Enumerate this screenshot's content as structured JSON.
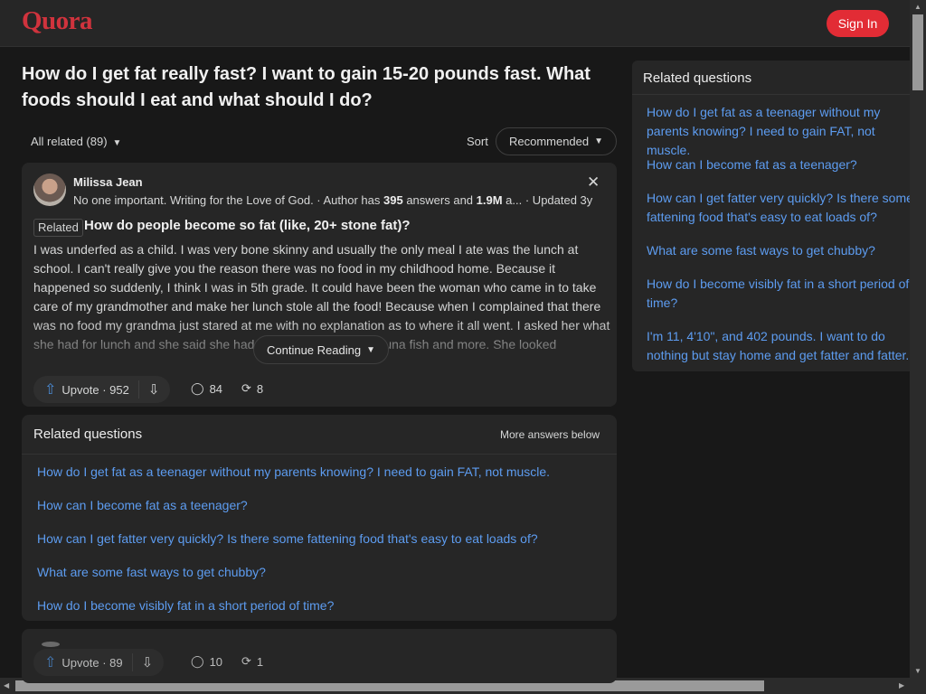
{
  "header": {
    "logo": "Quora",
    "signin_label": "Sign In"
  },
  "question": {
    "title": "How do I get fat really fast? I want to gain 15-20 pounds fast. What foods should I eat and what should I do?"
  },
  "filters": {
    "all_related": "All related (89)",
    "sort_label": "Sort",
    "sort_value": "Recommended"
  },
  "answer": {
    "author_name": "Milissa Jean",
    "cred_prefix": "No one important. Writing for the Love of God. · Author has ",
    "cred_answers": "395",
    "cred_mid": " answers and ",
    "cred_views": "1.9M",
    "cred_suffix": " a...",
    "updated": "· Updated 3y",
    "related_tag": "Related",
    "related_question": "How do people become so fat (like, 20+ stone fat)?",
    "text": "I was underfed as a child. I was very bone skinny and usually the only meal I ate was the lunch at school. I can't really give you the reason there was no food in my childhood home. Because it happened so suddenly, I think I was in 5th grade. It could have been the woman who came in to take care of my grandmother and make her lunch stole all the food! Because when I complained that there was no food my grandma just stared at me with no explanation as to where it all went. I asked her what she had for lunch and she said she had a delicious sandwich, tuna fish and more. She looked perplexed.",
    "continue_label": "Continue Reading",
    "upvote_label": "Upvote · 952",
    "comments": "84",
    "shares": "8"
  },
  "related_card": {
    "title": "Related questions",
    "more_label": "More answers below",
    "links": [
      "How do I get fat as a teenager without my parents knowing? I need to gain FAT, not muscle.",
      "How can I become fat as a teenager?",
      "How can I get fatter very quickly? Is there some fattening food that's easy to eat loads of?",
      "What are some fast ways to get chubby?",
      "How do I become visibly fat in a short period of time?"
    ]
  },
  "next_answer": {
    "upvote_label": "Upvote · 89",
    "comments": "10",
    "shares": "1"
  },
  "sidebar": {
    "title": "Related questions",
    "links": [
      "How do I get fat as a teenager without my parents knowing? I need to gain FAT, not muscle.",
      "How can I become fat as a teenager?",
      "How can I get fatter very quickly? Is there some fattening food that's easy to eat loads of?",
      "What are some fast ways to get chubby?",
      "How do I become visibly fat in a short period of time?",
      "I'm 11, 4'10\", and 402 pounds. I want to do nothing but stay home and get fatter and fatter."
    ]
  },
  "colors": {
    "brand": "#d0333d",
    "signin": "#e22c35",
    "link": "#5d9cf0",
    "upvote_icon": "#4a8ad3"
  },
  "icons": [
    "close-icon",
    "chevron-down-icon",
    "upvote-arrow-icon",
    "downvote-arrow-icon",
    "comment-icon",
    "share-icon"
  ]
}
